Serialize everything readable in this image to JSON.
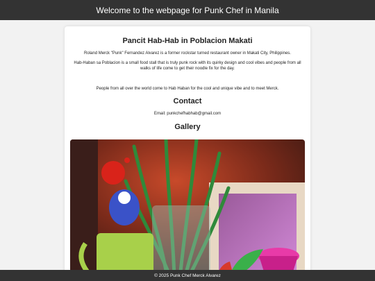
{
  "header": {
    "title": "Welcome to the webpage for Punk Chef in Manila"
  },
  "main": {
    "title": "Pancit Hab-Hab in Poblacion Makati",
    "intro": "Roland Merck \"Punk\" Fernandez Alvarez is a former rockstar turned restaurant owner in Makati City, Philippines.",
    "description": "Hab-Haban sa Poblacion is a small food stall that is truly punk rock with its quirky design and cool vibes and people from all walks of life come to get their noodle fix for the day.",
    "people": "People from all over the world come to Hab Haban for the cool and unique vibe and to meet Merck.",
    "contact_heading": "Contact",
    "email": "Email: punkchefhabhab@gmail.com",
    "gallery_heading": "Gallery"
  },
  "footer": {
    "text": "© 2025 Punk Chef Merck Alvarez"
  },
  "colors": {
    "header_bg": "#333333",
    "footer_bg": "#333333",
    "page_bg": "#f2f2f2",
    "card_bg": "#ffffff"
  }
}
